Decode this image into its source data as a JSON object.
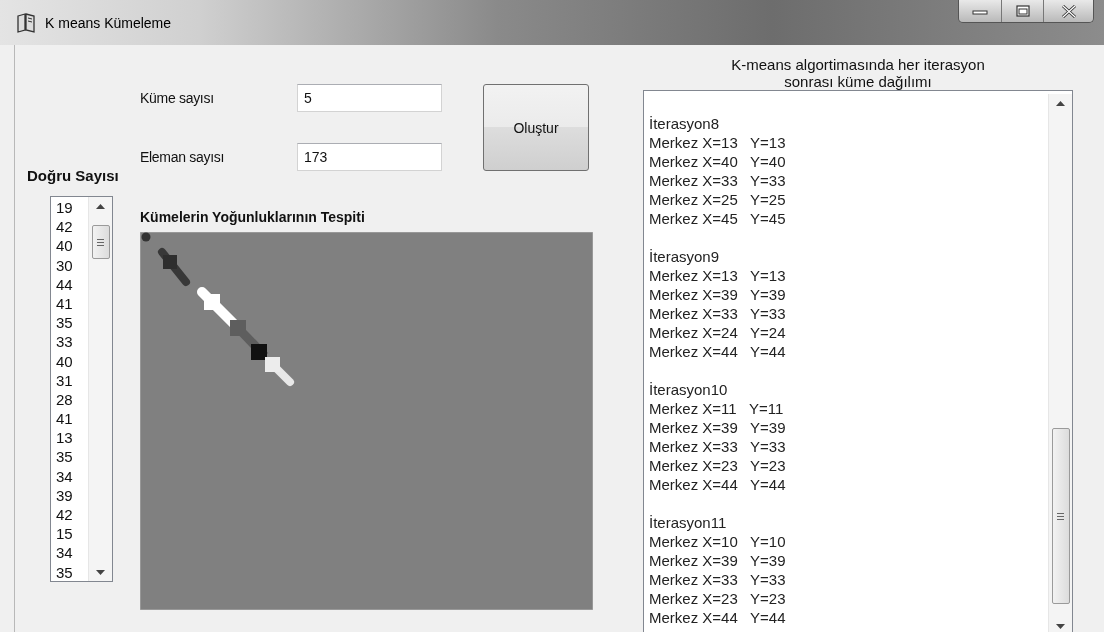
{
  "window": {
    "title": "K means Kümeleme"
  },
  "fields": [
    {
      "label": "Küme sayısı",
      "value": "5"
    },
    {
      "label": "Eleman sayısı",
      "value": "173"
    }
  ],
  "create_button": {
    "label": "Oluştur"
  },
  "correct_count": {
    "label": "Doğru Sayısı",
    "items": [
      "19",
      "42",
      "40",
      "30",
      "44",
      "41",
      "35",
      "33",
      "40",
      "31",
      "28",
      "41",
      "13",
      "35",
      "34",
      "39",
      "42",
      "15",
      "34",
      "35"
    ]
  },
  "density_panel": {
    "title": "Kümelerin Yoğunluklarının Tespiti"
  },
  "iteration_log": {
    "title": "K-means algortimasında her iterasyon sonrası küme dağılımı",
    "iterations": [
      {
        "title": "İterasyon8",
        "centers": [
          "Merkez X=13   Y=13",
          "Merkez X=40   Y=40",
          "Merkez X=33   Y=33",
          "Merkez X=25   Y=25",
          "Merkez X=45   Y=45"
        ]
      },
      {
        "title": "İterasyon9",
        "centers": [
          "Merkez X=13   Y=13",
          "Merkez X=39   Y=39",
          "Merkez X=33   Y=33",
          "Merkez X=24   Y=24",
          "Merkez X=44   Y=44"
        ]
      },
      {
        "title": "İterasyon10",
        "centers": [
          "Merkez X=11   Y=11",
          "Merkez X=39   Y=39",
          "Merkez X=33   Y=33",
          "Merkez X=23   Y=23",
          "Merkez X=44   Y=44"
        ]
      },
      {
        "title": "İterasyon11",
        "centers": [
          "Merkez X=10   Y=10",
          "Merkez X=39   Y=39",
          "Merkez X=33   Y=33",
          "Merkez X=23   Y=23",
          "Merkez X=44   Y=44"
        ]
      }
    ]
  }
}
